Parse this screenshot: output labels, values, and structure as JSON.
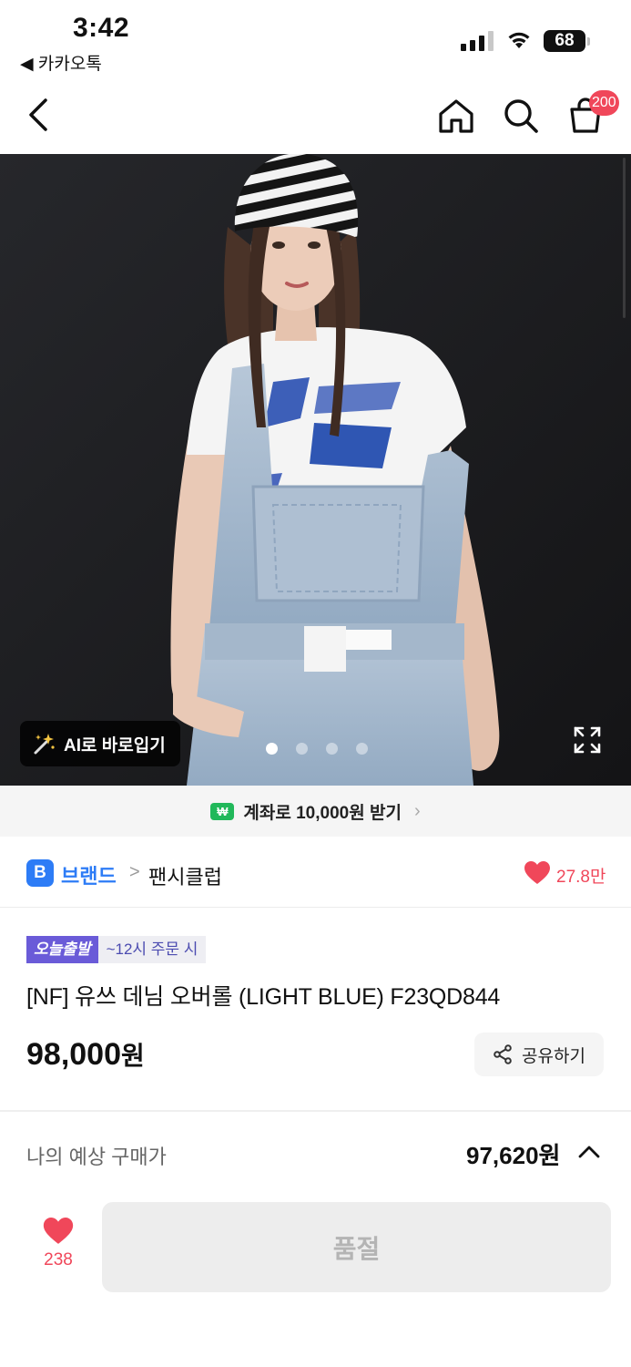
{
  "status_bar": {
    "time": "3:42",
    "back_app": "◀ 카카오톡",
    "battery": "68"
  },
  "nav": {
    "cart_badge": "200"
  },
  "hero": {
    "ai_button_label": "AI로 바로입기",
    "page_dots": 4,
    "active_dot": 0
  },
  "promo": {
    "badge": "₩",
    "text": "계좌로 10,000원 받기"
  },
  "brand": {
    "badge": "B",
    "label": "브랜드",
    "separator": ">",
    "name": "팬시클럽",
    "likes": "27.8만"
  },
  "product": {
    "tag_today": "오늘출발",
    "tag_time": "~12시 주문 시",
    "title": "[NF] 유쓰 데님 오버롤 (LIGHT BLUE) F23QD844",
    "price": "98,000",
    "price_unit": "원",
    "share_label": "공유하기"
  },
  "expected": {
    "label": "나의 예상 구매가",
    "price": "97,620원"
  },
  "bottom": {
    "wish_count": "238",
    "buy_button": "품절"
  },
  "colors": {
    "accent_red": "#f0475a",
    "brand_blue": "#2d7cf6",
    "today_purple": "#6a5bd8",
    "promo_green": "#21b85a"
  }
}
